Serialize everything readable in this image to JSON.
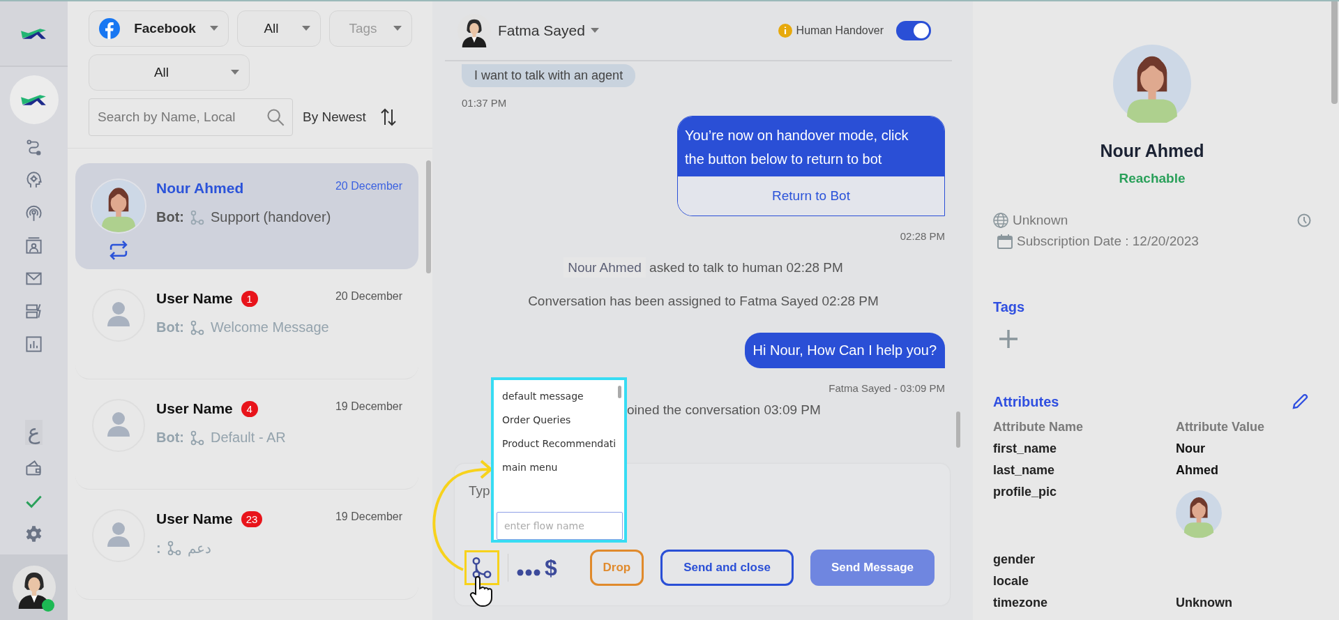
{
  "nav": {
    "language_key": "ع",
    "agent_online": true
  },
  "filter_rows": [
    [
      {
        "kind": "channel",
        "value": "Facebook"
      },
      {
        "kind": "select",
        "value": "All"
      },
      {
        "kind": "select",
        "placeholder": "Tags"
      }
    ],
    [
      {
        "kind": "select",
        "value": "All"
      }
    ]
  ],
  "search": {
    "placeholder": "Search by Name, Local"
  },
  "sort": {
    "label": "By Newest"
  },
  "conversations": [
    {
      "name": "Nour Ahmed",
      "date": "20 December",
      "selected": true,
      "kind": "contact",
      "handover": true,
      "bot_label": "Bot:",
      "flow": "Support (handover)"
    },
    {
      "name": "User Name",
      "date": "20 December",
      "selected": false,
      "kind": "anonymous",
      "handover": false,
      "unread": "1",
      "bot_label": "Bot:",
      "flow": "Welcome Message"
    },
    {
      "name": "User Name",
      "date": "19 December",
      "selected": false,
      "kind": "anonymous",
      "handover": false,
      "unread": "4",
      "bot_label": "Bot:",
      "flow": "Default - AR"
    },
    {
      "name": "User Name",
      "date": "19 December",
      "selected": false,
      "kind": "anonymous",
      "handover": false,
      "unread": "23",
      "bot_label": ":",
      "flow": "دعم"
    }
  ],
  "chat": {
    "agent": "Fatma Sayed",
    "handover": {
      "label": "Human Handover",
      "on": true
    },
    "messages": [
      {
        "kind": "incoming",
        "text": "I want to talk with an agent"
      },
      {
        "kind": "time_left",
        "text": "01:37 PM"
      },
      {
        "kind": "card",
        "text": "You’re now on handover mode, click the button below to return to bot",
        "button": "Return to Bot"
      },
      {
        "kind": "time_right",
        "text": "02:28 PM"
      },
      {
        "kind": "system",
        "name": "Nour Ahmed",
        "text": "asked to talk to human 02:28 PM"
      },
      {
        "kind": "system",
        "text": "Conversation has been assigned to Fatma Sayed 02:28 PM"
      },
      {
        "kind": "outgoing",
        "text": "Hi Nour, How Can I help you?"
      },
      {
        "kind": "time_right",
        "text": "Fatma Sayed - 03:09 PM"
      },
      {
        "kind": "system_partial",
        "text": "oined the conversation 03:09 PM"
      }
    ],
    "composer": {
      "placeholder": "Typ",
      "currency": "$",
      "buttons": [
        {
          "label": "Drop",
          "kind": "warning"
        },
        {
          "label": "Send and close",
          "kind": "outline"
        },
        {
          "label": "Send Message",
          "kind": "primary"
        }
      ]
    },
    "flow_picker": {
      "items": [
        "default message",
        "Order Queries",
        "Product Recommendati",
        "main menu"
      ],
      "placeholder": "enter flow name"
    }
  },
  "contact": {
    "name": "Nour Ahmed",
    "status": "Reachable",
    "location": "Unknown",
    "subscription": "Subscription Date : 12/20/2023",
    "tags_title": "Tags",
    "attributes_title": "Attributes",
    "columns": [
      "Attribute Name",
      "Attribute Value"
    ],
    "attributes": [
      {
        "kind": "text",
        "name": "first_name",
        "value": "Nour"
      },
      {
        "kind": "text",
        "name": "last_name",
        "value": "Ahmed"
      },
      {
        "name": "profile_pic"
      },
      {
        "kind": "text",
        "name": "gender"
      },
      {
        "kind": "text",
        "name": "locale"
      },
      {
        "kind": "plain",
        "name": "timezone",
        "value": "Unknown"
      }
    ]
  }
}
